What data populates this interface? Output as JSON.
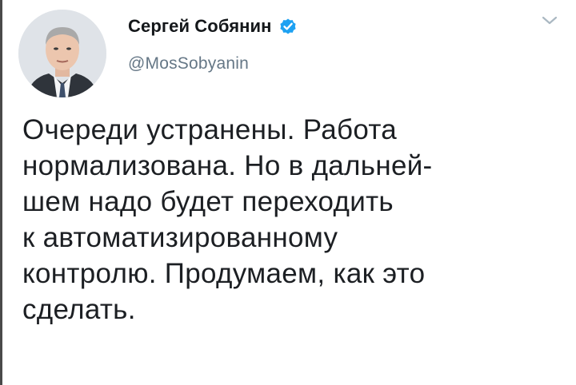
{
  "author": {
    "display_name": "Сергей Собянин",
    "handle": "@MosSobyanin",
    "verified": true,
    "verified_icon": "verified-badge-icon",
    "avatar_icon": "avatar-photo"
  },
  "menu": {
    "icon": "chevron-down-icon"
  },
  "tweet": {
    "lines": [
      "Очереди устранены. Работа",
      "нормализована. Но в дальней-",
      "шем надо будет переходить",
      "к автоматизированному",
      "контролю. Продумаем, как это",
      "сделать."
    ]
  },
  "colors": {
    "verified_blue": "#1da1f2",
    "handle_gray": "#657786",
    "text_dark": "#14171a"
  }
}
